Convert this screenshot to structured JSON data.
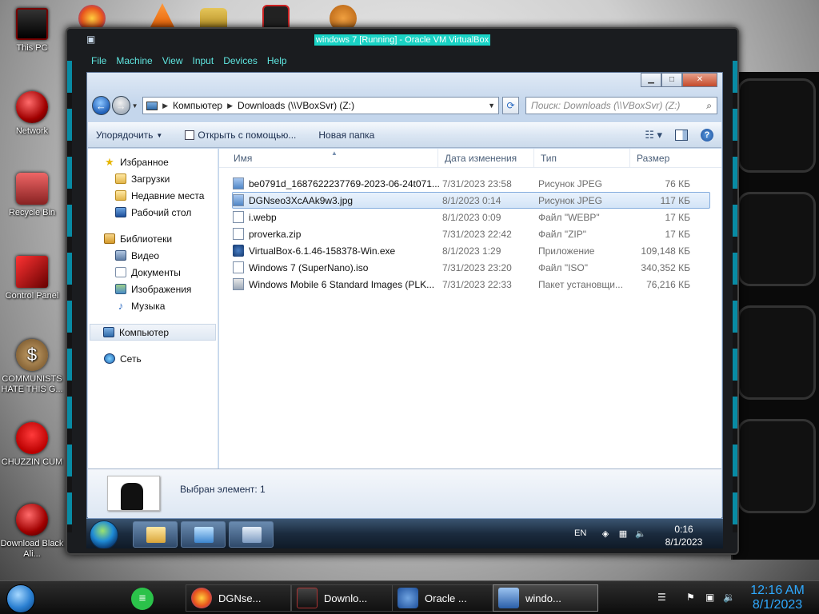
{
  "desktop": {
    "icons": [
      {
        "label": "This PC"
      },
      {
        "label": "Network"
      },
      {
        "label": "Recycle Bin"
      },
      {
        "label": "Control Panel"
      },
      {
        "label": "COMMUNISTS HATE THIS G..."
      },
      {
        "label": "CHUZZIN CUM"
      },
      {
        "label": "Download Black Ali..."
      }
    ]
  },
  "vbox": {
    "title": "windows 7 [Running] - Oracle VM VirtualBox",
    "menu": [
      "File",
      "Machine",
      "View",
      "Input",
      "Devices",
      "Help"
    ]
  },
  "explorer": {
    "address": {
      "root": "Компьютер",
      "path": "Downloads (\\\\VBoxSvr) (Z:)"
    },
    "search_placeholder": "Поиск: Downloads (\\\\VBoxSvr) (Z:)",
    "toolbar": {
      "organize": "Упорядочить",
      "open_with": "Открыть с помощью...",
      "new_folder": "Новая папка"
    },
    "nav": {
      "favorites": "Избранное",
      "downloads": "Загрузки",
      "recent": "Недавние места",
      "desktop": "Рабочий стол",
      "libraries": "Библиотеки",
      "video": "Видео",
      "documents": "Документы",
      "images": "Изображения",
      "music": "Музыка",
      "computer": "Компьютер",
      "network": "Сеть"
    },
    "columns": {
      "name": "Имя",
      "date": "Дата изменения",
      "type": "Тип",
      "size": "Размер"
    },
    "files": [
      {
        "name": "be0791d_1687622237769-2023-06-24t071...",
        "date": "7/31/2023 23:58",
        "type": "Рисунок JPEG",
        "size": "76 КБ"
      },
      {
        "name": "DGNseo3XcAAk9w3.jpg",
        "date": "8/1/2023 0:14",
        "type": "Рисунок JPEG",
        "size": "117 КБ"
      },
      {
        "name": "i.webp",
        "date": "8/1/2023 0:09",
        "type": "Файл \"WEBP\"",
        "size": "17 КБ"
      },
      {
        "name": "proverka.zip",
        "date": "7/31/2023 22:42",
        "type": "Файл \"ZIP\"",
        "size": "17 КБ"
      },
      {
        "name": "VirtualBox-6.1.46-158378-Win.exe",
        "date": "8/1/2023 1:29",
        "type": "Приложение",
        "size": "109,148 КБ"
      },
      {
        "name": "Windows 7 (SuperNano).iso",
        "date": "7/31/2023 23:20",
        "type": "Файл \"ISO\"",
        "size": "340,352 КБ"
      },
      {
        "name": "Windows Mobile 6 Standard Images (PLK...",
        "date": "7/31/2023 22:33",
        "type": "Пакет установщи...",
        "size": "76,216 КБ"
      }
    ],
    "status": "Выбран элемент: 1"
  },
  "guest_taskbar": {
    "lang": "EN",
    "time": "0:16",
    "date": "8/1/2023"
  },
  "host_taskbar": {
    "tasks": [
      "DGNse...",
      "Downlo...",
      "Oracle ...",
      "windo..."
    ],
    "time": "12:16 AM",
    "date": "8/1/2023"
  }
}
